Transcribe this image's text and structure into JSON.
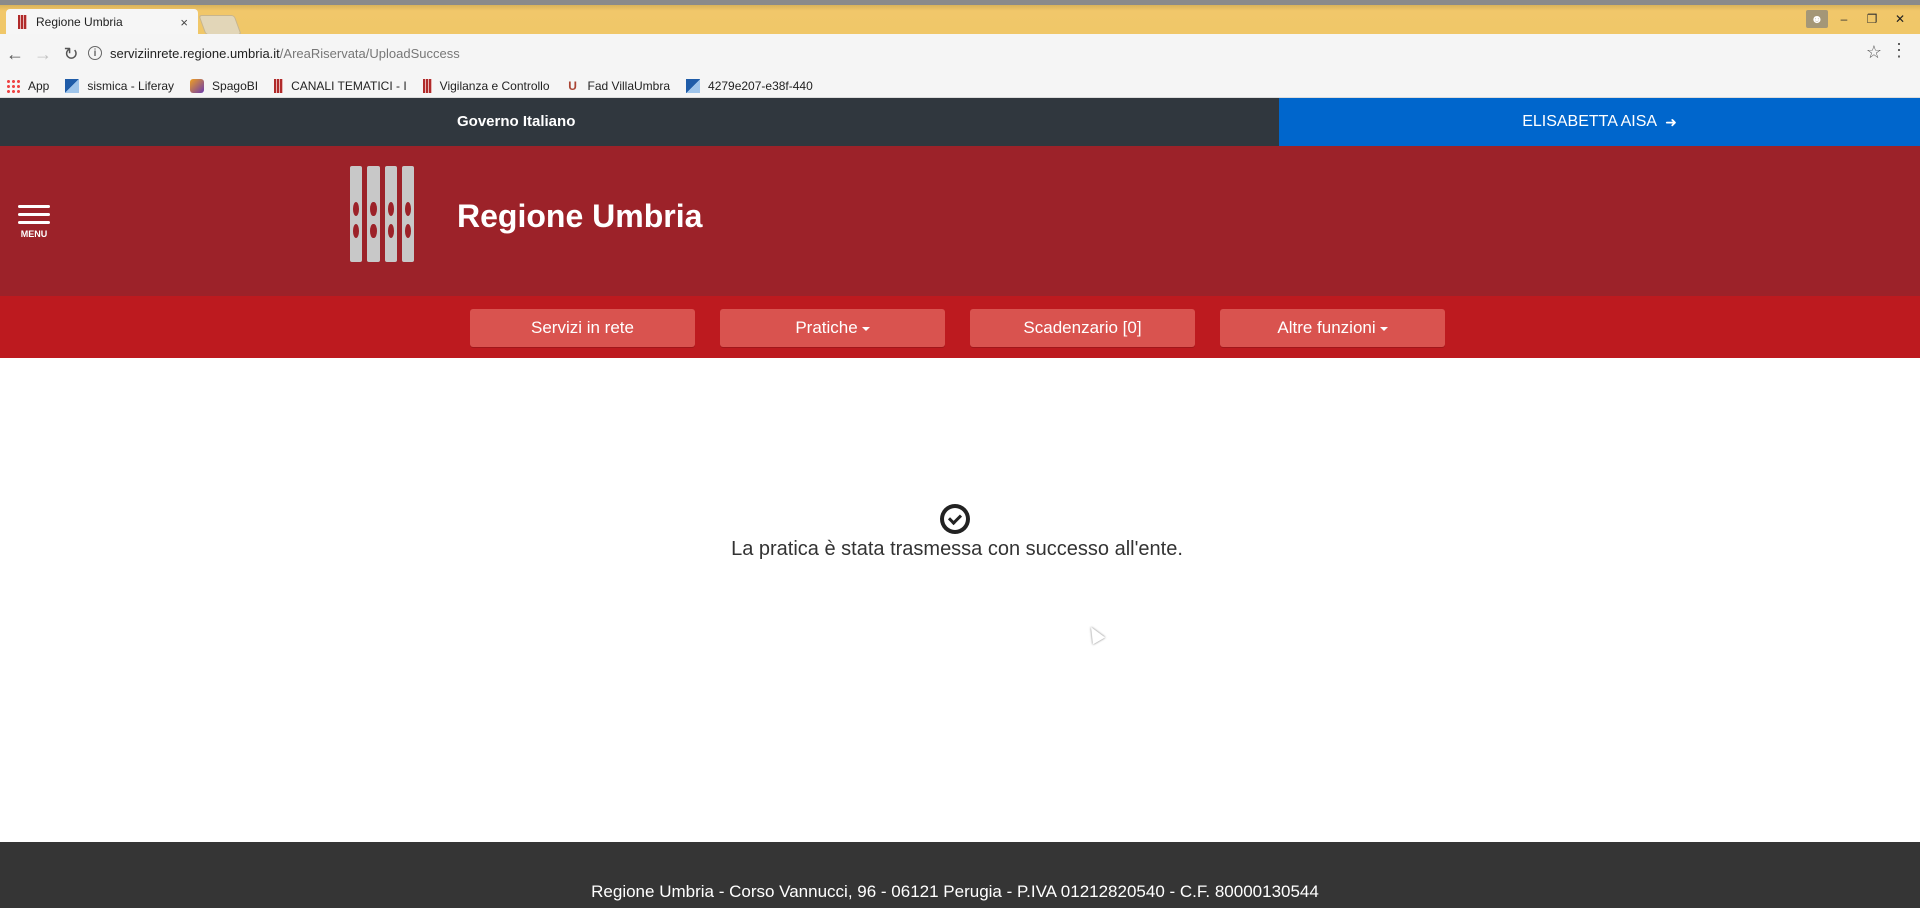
{
  "browser": {
    "tab_title": "Regione Umbria",
    "tab_close": "×",
    "url_host": "serviziinrete.regione.umbria.it",
    "url_path": "/AreaRiservata/UploadSuccess",
    "bookmarks": [
      "App",
      "sismica - Liferay",
      "SpagoBI",
      "CANALI TEMATICI - I",
      "Vigilanza e Controllo",
      "Fad VillaUmbra",
      "4279e207-e38f-440"
    ]
  },
  "gov_bar": {
    "label": "Governo Italiano",
    "user_name": "ELISABETTA AISA"
  },
  "header": {
    "menu_label": "MENU",
    "site_title": "Regione Umbria",
    "brand_color": "#9c2229"
  },
  "nav": {
    "items": [
      {
        "label": "Servizi in rete"
      },
      {
        "label": "Pratiche"
      },
      {
        "label": "Scadenzario [0]"
      },
      {
        "label": "Altre funzioni"
      }
    ]
  },
  "main": {
    "icon": "check-circle-icon",
    "message": "La pratica è stata trasmessa con successo all'ente."
  },
  "footer": {
    "text": "Regione Umbria - Corso Vannucci, 96 - 06121 Perugia - P.IVA 01212820540 - C.F. 80000130544"
  }
}
